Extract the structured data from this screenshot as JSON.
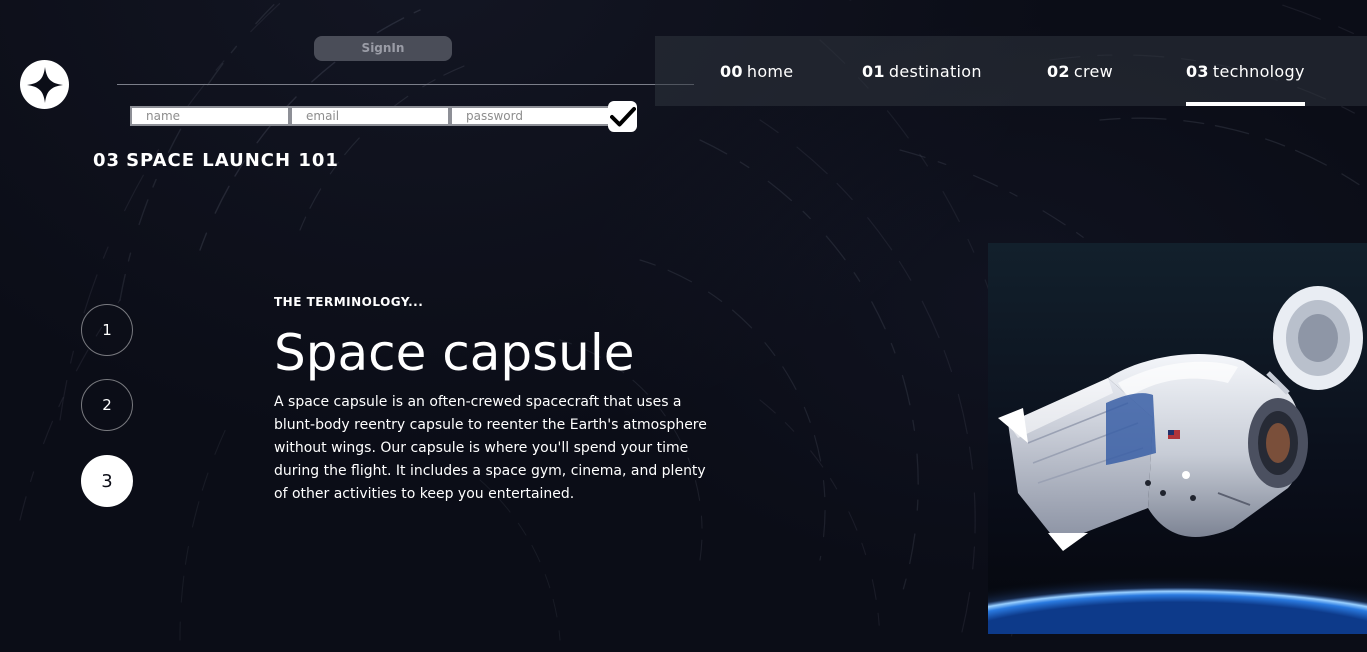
{
  "auth": {
    "signin_label": "SignIn",
    "name_placeholder": "name",
    "email_placeholder": "email",
    "password_placeholder": "password"
  },
  "nav": {
    "items": [
      {
        "num": "00",
        "label": "home"
      },
      {
        "num": "01",
        "label": "destination"
      },
      {
        "num": "02",
        "label": "crew"
      },
      {
        "num": "03",
        "label": "technology"
      }
    ],
    "active": "technology"
  },
  "page": {
    "num": "03",
    "title": "SPACE LAUNCH 101"
  },
  "steps": [
    "1",
    "2",
    "3"
  ],
  "active_step": "3",
  "article": {
    "eyebrow": "THE TERMINOLOGY...",
    "title": "Space capsule",
    "description": "A space capsule is an often-crewed spacecraft that uses a blunt-body reentry capsule to reenter the Earth's atmosphere without wings. Our capsule is where you'll spend your time during the flight. It includes a space gym, cinema, and plenty of other activities to keep you entertained."
  },
  "colors": {
    "background": "#0b0d17",
    "text": "#ffffff",
    "nav_background": "#30343e",
    "signin_button": "#4a4d58"
  }
}
